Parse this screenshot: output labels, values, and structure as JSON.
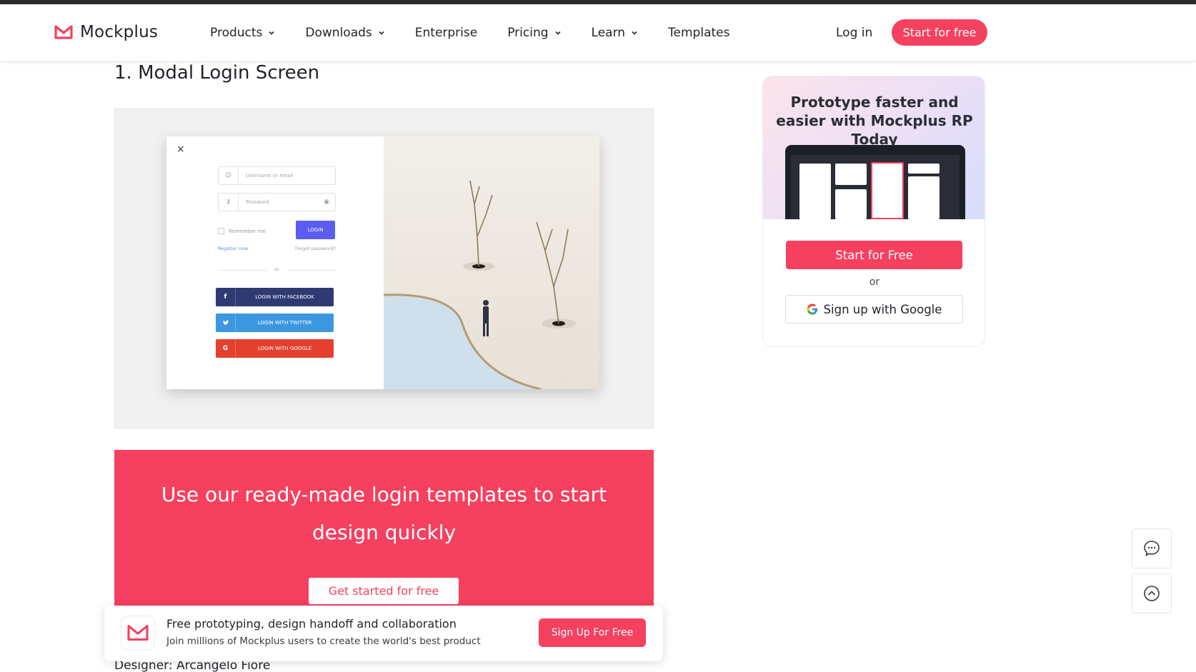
{
  "header": {
    "brand": "Mockplus",
    "nav": [
      {
        "label": "Products",
        "has_dropdown": true
      },
      {
        "label": "Downloads",
        "has_dropdown": true
      },
      {
        "label": "Enterprise",
        "has_dropdown": false
      },
      {
        "label": "Pricing",
        "has_dropdown": true
      },
      {
        "label": "Learn",
        "has_dropdown": true
      },
      {
        "label": "Templates",
        "has_dropdown": false
      }
    ],
    "login": "Log in",
    "start": "Start for free"
  },
  "article": {
    "title": "1. Modal Login Screen",
    "designer": "Designer: Arcangelo Fiore"
  },
  "shot": {
    "close": "×",
    "username_placeholder": "Username or email",
    "password_placeholder": "Password",
    "remember": "Remember me",
    "login": "LOGIN",
    "register": "Register now",
    "forgot": "Forgot password?",
    "or": "or",
    "facebook": "LOGIN WITH FACEBOOK",
    "twitter": "LOGIN WITH TWITTER",
    "google": "LOGIN WITH GOOGLE",
    "facebook_glyph": "f",
    "google_glyph": "G"
  },
  "promo": {
    "text": "Use our ready-made login templates to start design quickly",
    "button": "Get started for free"
  },
  "sticky": {
    "title": "Free prototyping, design handoff and collaboration",
    "subtitle": "Join millions of Mockplus users to create the world's best product",
    "button": "Sign Up For Free"
  },
  "sidebar": {
    "heading": "Prototype faster and easier with Mockplus RP Today",
    "cta": "Start for Free",
    "or": "or",
    "google": "Sign up with Google"
  },
  "colors": {
    "accent": "#f6405f",
    "login_button": "#5a5df0",
    "facebook": "#2f3a73",
    "twitter": "#3c97e0",
    "google": "#e3412d"
  },
  "icons": [
    "mockplus-logo-icon",
    "chevron-down-icon",
    "close-icon",
    "user-icon",
    "key-icon",
    "eye-icon",
    "facebook-icon",
    "twitter-icon",
    "google-icon",
    "chat-icon",
    "back-to-top-icon"
  ]
}
